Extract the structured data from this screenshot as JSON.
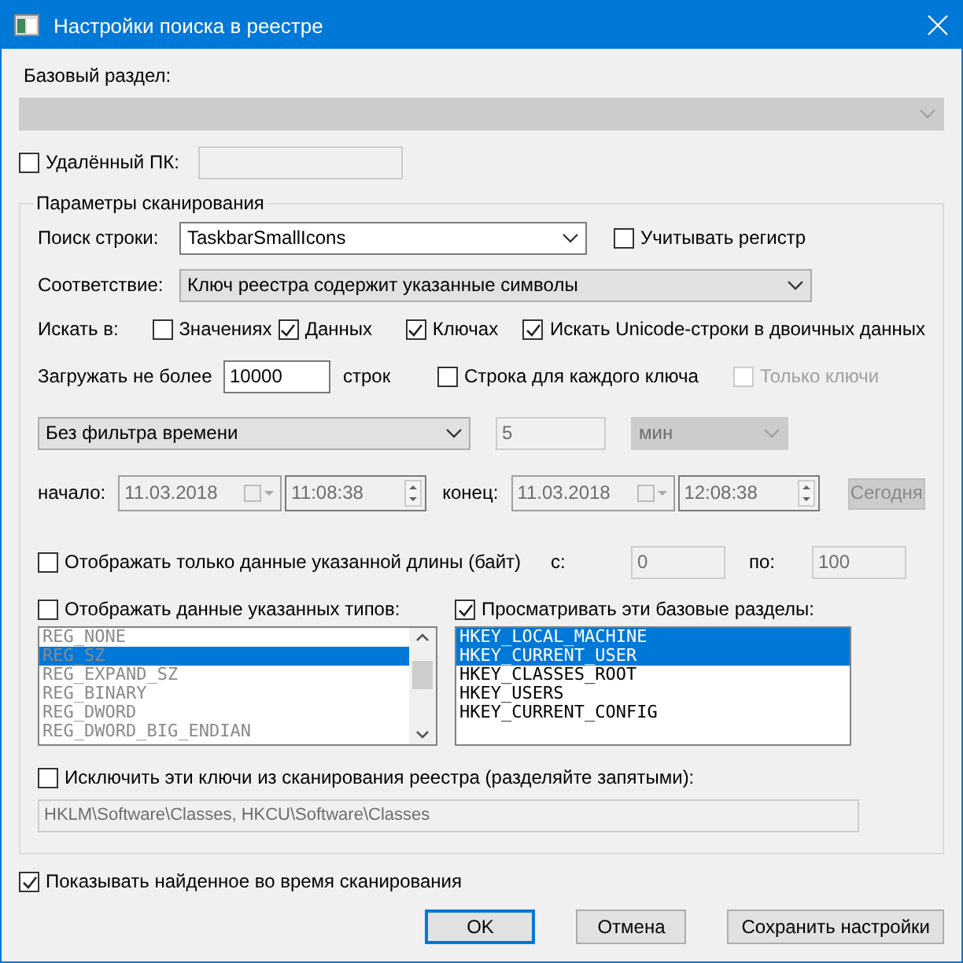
{
  "window": {
    "title": "Настройки поиска в реестре"
  },
  "base_section": {
    "label": "Базовый раздел:",
    "disabled": true
  },
  "remote_pc": {
    "label": "Удалённый ПК:",
    "checked": false,
    "disabled": true
  },
  "scan_group": {
    "title": "Параметры сканирования",
    "search_string": {
      "label": "Поиск строки:",
      "value": "TaskbarSmallIcons"
    },
    "case_sensitive": {
      "label": "Учитывать регистр",
      "checked": false
    },
    "match": {
      "label": "Соответствие:",
      "value": "Ключ реестра содержит указанные символы"
    },
    "search_in": {
      "label": "Искать в:",
      "options": [
        {
          "label": "Значениях",
          "checked": false
        },
        {
          "label": "Данных",
          "checked": true
        },
        {
          "label": "Ключах",
          "checked": true
        },
        {
          "label": "Искать Unicode-строки в двоичных данных",
          "checked": true
        }
      ]
    },
    "load_limit": {
      "label": "Загружать не более",
      "value": "10000",
      "unit": "строк"
    },
    "row_per_key": {
      "label": "Строка для каждого ключа",
      "checked": false,
      "disabled": false
    },
    "keys_only": {
      "label": "Только ключи",
      "checked": false,
      "disabled": true
    },
    "time_filter": {
      "value": "Без фильтра времени",
      "amount": "5",
      "unit": "мин",
      "disabled": true
    },
    "start": {
      "label": "начало:",
      "date": "11.03.2018",
      "time": "11:08:38"
    },
    "end": {
      "label": "конец:",
      "date": "11.03.2018",
      "time": "12:08:38"
    },
    "today_button": "Сегодня",
    "length_filter": {
      "label": "Отображать только данные указанной длины (байт)",
      "checked": false,
      "from_label": "с:",
      "from": "0",
      "to_label": "по:",
      "to": "100"
    },
    "types": {
      "label": "Отображать данные указанных типов:",
      "checked": false,
      "items": [
        {
          "label": "REG_NONE",
          "selected": false
        },
        {
          "label": "REG_SZ",
          "selected": true
        },
        {
          "label": "REG_EXPAND_SZ",
          "selected": false
        },
        {
          "label": "REG_BINARY",
          "selected": false
        },
        {
          "label": "REG_DWORD",
          "selected": false
        },
        {
          "label": "REG_DWORD_BIG_ENDIAN",
          "selected": false
        }
      ]
    },
    "base_keys": {
      "label": "Просматривать эти базовые разделы:",
      "checked": true,
      "items": [
        {
          "label": "HKEY_LOCAL_MACHINE",
          "selected": true
        },
        {
          "label": "HKEY_CURRENT_USER",
          "selected": true
        },
        {
          "label": "HKEY_CLASSES_ROOT",
          "selected": false
        },
        {
          "label": "HKEY_USERS",
          "selected": false
        },
        {
          "label": "HKEY_CURRENT_CONFIG",
          "selected": false
        }
      ]
    },
    "exclude": {
      "label": "Исключить эти ключи из сканирования реестра (разделяйте запятыми):",
      "checked": false,
      "value": "HKLM\\Software\\Classes, HKCU\\Software\\Classes"
    }
  },
  "show_found": {
    "label": "Показывать найденное во время сканирования",
    "checked": true
  },
  "buttons": [
    {
      "label": "OK",
      "default": true
    },
    {
      "label": "Отмена",
      "default": false
    },
    {
      "label": "Сохранить настройки",
      "default": false
    }
  ]
}
